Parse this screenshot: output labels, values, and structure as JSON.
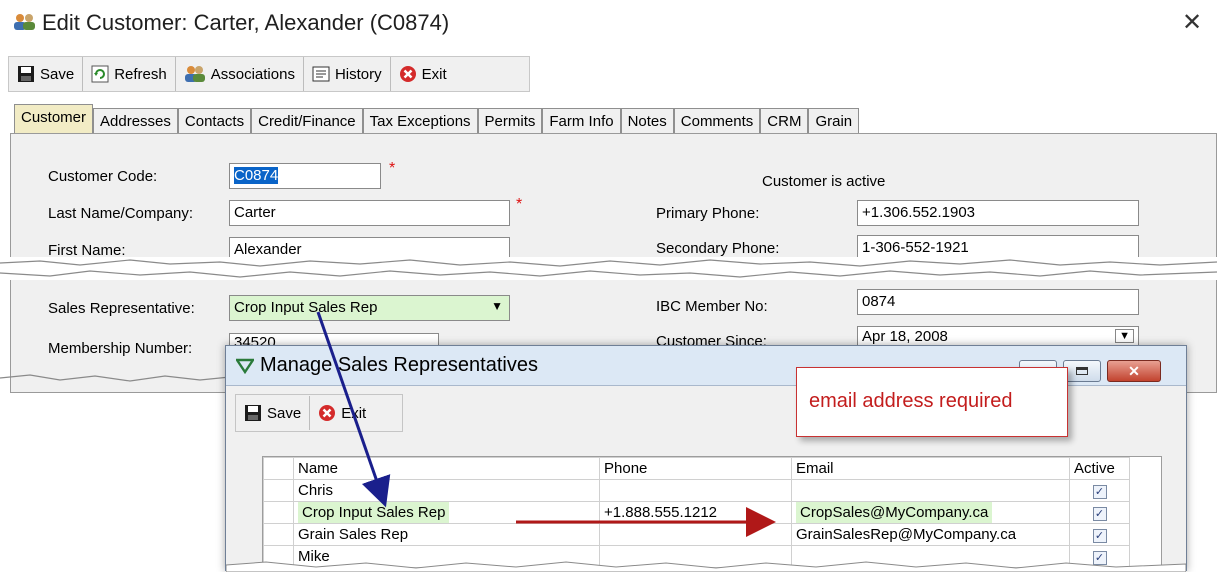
{
  "window": {
    "title": "Edit Customer: Carter, Alexander (C0874)",
    "close_glyph": "✕"
  },
  "toolbar": {
    "save": "Save",
    "refresh": "Refresh",
    "associations": "Associations",
    "history": "History",
    "exit": "Exit"
  },
  "tabs": [
    "Customer",
    "Addresses",
    "Contacts",
    "Credit/Finance",
    "Tax Exceptions",
    "Permits",
    "Farm Info",
    "Notes",
    "Comments",
    "CRM",
    "Grain"
  ],
  "form": {
    "customer_code_label": "Customer Code:",
    "customer_code_value": "C0874",
    "last_name_label": "Last Name/Company:",
    "last_name_value": "Carter",
    "first_name_label": "First Name:",
    "first_name_value": "Alexander",
    "sales_rep_label": "Sales Representative:",
    "sales_rep_value": "Crop Input Sales Rep",
    "membership_label": "Membership Number:",
    "membership_value": "34520",
    "status_text": "Customer is active",
    "primary_phone_label": "Primary Phone:",
    "primary_phone_value": "+1.306.552.1903",
    "secondary_phone_label": "Secondary Phone:",
    "secondary_phone_value": "1-306-552-1921",
    "ibc_label": "IBC Member No:",
    "ibc_value": "0874",
    "customer_since_label": "Customer Since:",
    "customer_since_value": "Apr 18, 2008",
    "required_mark": "*"
  },
  "dialog": {
    "title": "Manage Sales Representatives",
    "save": "Save",
    "exit": "Exit",
    "columns": [
      "Name",
      "Phone",
      "Email",
      "Active"
    ],
    "rows": [
      {
        "name": "Chris",
        "phone": "",
        "email": "",
        "active": true
      },
      {
        "name": "Crop Input Sales Rep",
        "phone": "+1.888.555.1212",
        "email": "CropSales@MyCompany.ca",
        "active": true
      },
      {
        "name": "Grain Sales Rep",
        "phone": "",
        "email": "GrainSalesRep@MyCompany.ca",
        "active": true
      },
      {
        "name": "Mike",
        "phone": "",
        "email": "",
        "active": true
      }
    ]
  },
  "callout": {
    "text": "email address required"
  },
  "colors": {
    "highlight": "#dbf5d0",
    "arrow_blue": "#1a1f8c",
    "arrow_red": "#b01818",
    "active_tab": "#f2ecc5"
  }
}
